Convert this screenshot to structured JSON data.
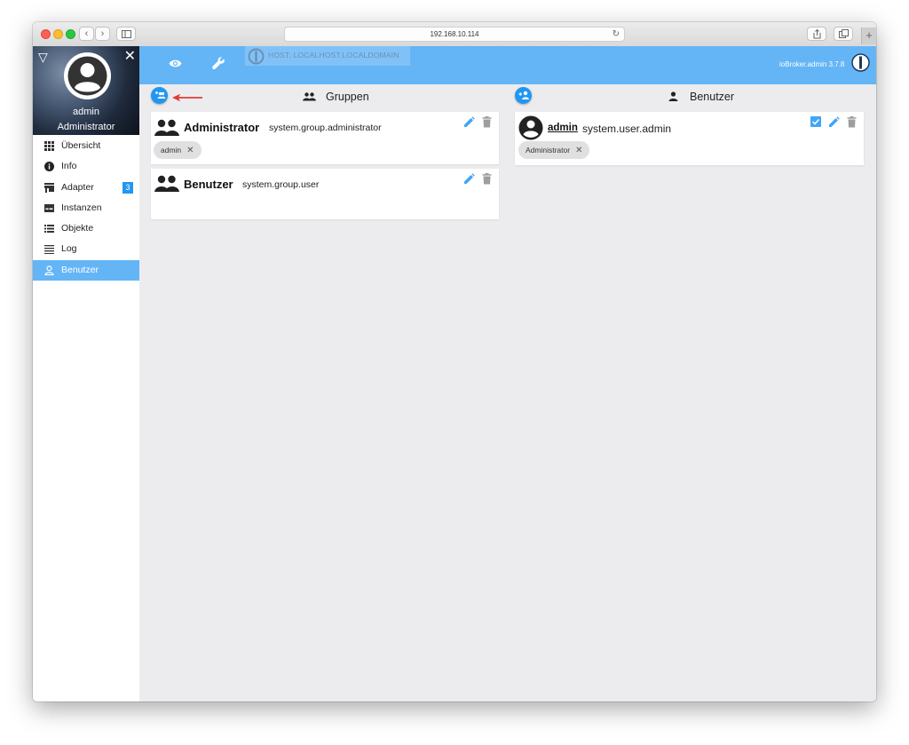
{
  "browser": {
    "url": "192.168.10.114",
    "reload_icon": "reload-icon",
    "new_tab_icon": "plus-icon"
  },
  "sidebar": {
    "user_name": "admin",
    "user_role": "Administrator",
    "items": [
      {
        "label": "Übersicht",
        "icon": "grid-icon"
      },
      {
        "label": "Info",
        "icon": "info-icon"
      },
      {
        "label": "Adapter",
        "icon": "store-icon",
        "badge": "3"
      },
      {
        "label": "Instanzen",
        "icon": "instances-icon"
      },
      {
        "label": "Objekte",
        "icon": "list-icon"
      },
      {
        "label": "Log",
        "icon": "log-icon"
      },
      {
        "label": "Benutzer",
        "icon": "person-icon",
        "active": true
      }
    ]
  },
  "appbar": {
    "host_label": "HOST: LOCALHOST.LOCALDOMAIN",
    "version": "ioBroker.admin 3.7.8"
  },
  "groups": {
    "header": "Gruppen",
    "items": [
      {
        "title": "Administrator",
        "id": "system.group.administrator",
        "chips": [
          "admin"
        ]
      },
      {
        "title": "Benutzer",
        "id": "system.group.user",
        "chips": []
      }
    ]
  },
  "users": {
    "header": "Benutzer",
    "items": [
      {
        "title": "admin",
        "id": "system.user.admin",
        "chips": [
          "Administrator"
        ],
        "enabled": true
      }
    ]
  },
  "colors": {
    "accent": "#64b5f6",
    "primary": "#2196f3",
    "annotation_arrow": "#e53935"
  }
}
